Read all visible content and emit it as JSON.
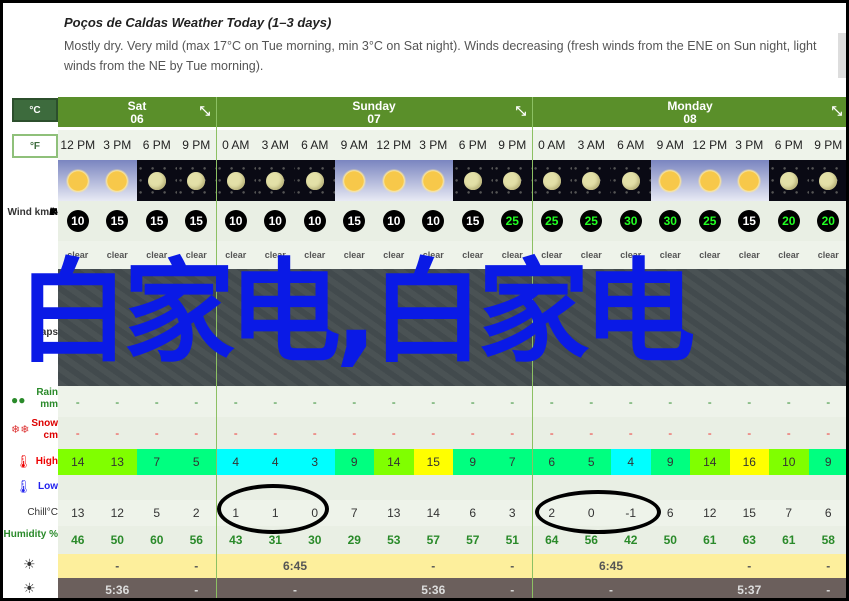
{
  "header": {
    "title": "Poços de Caldas Weather Today (1–3 days)",
    "description_line1": "Mostly dry. Very mild (max 17°C on Tue morning, min 3°C on Sat night). Winds decreasing (fresh winds from the ENE on Sun night, light",
    "description_line2": "winds from the NE by Tue morning)."
  },
  "units": {
    "celsius": "°C",
    "fahrenheit": "°F",
    "selected": "celsius"
  },
  "row_labels": {
    "wind": "Wind km/h",
    "maps": "Maps",
    "rain": "Rain mm",
    "snow": "Snow cm",
    "high": "High",
    "low": "Low",
    "chill": "Chill°C",
    "humidity": "Humidity %"
  },
  "days": [
    {
      "name": "Sat",
      "date": "06",
      "times": [
        "12 PM",
        "3 PM",
        "6 PM",
        "9 PM"
      ],
      "sky": [
        "day",
        "day",
        "night",
        "night"
      ],
      "wind": [
        10,
        15,
        15,
        15
      ],
      "wind_dir": [
        "→",
        "↗",
        "↗",
        "↗"
      ],
      "summary": [
        "clear",
        "clear",
        "clear",
        "clear"
      ],
      "rain": [
        "-",
        "-",
        "-",
        "-"
      ],
      "snow": [
        "-",
        "-",
        "-",
        "-"
      ],
      "high": [
        14,
        13,
        7,
        5
      ],
      "low": [
        "",
        "",
        "",
        ""
      ],
      "chill": [
        13,
        12,
        5,
        2
      ],
      "humidity": [
        46,
        50,
        60,
        56
      ],
      "sunrise": [
        [
          "",
          1
        ],
        [
          "-",
          1
        ],
        [
          "",
          1
        ],
        [
          "-",
          1
        ]
      ],
      "sunset": [
        [
          "",
          1
        ],
        [
          "5:36",
          1
        ],
        [
          "",
          1
        ],
        [
          "-",
          1
        ]
      ]
    },
    {
      "name": "Sunday",
      "date": "07",
      "times": [
        "0 AM",
        "3 AM",
        "6 AM",
        "9 AM",
        "12 PM",
        "3 PM",
        "6 PM",
        "9 PM"
      ],
      "sky": [
        "night",
        "night",
        "night",
        "day",
        "day",
        "day",
        "night",
        "night"
      ],
      "wind": [
        10,
        10,
        10,
        15,
        10,
        10,
        15,
        25
      ],
      "wind_dir": [
        "↖",
        "↖",
        "↖",
        "←",
        "↙",
        "←",
        "←",
        "↙"
      ],
      "summary": [
        "clear",
        "clear",
        "clear",
        "clear",
        "clear",
        "clear",
        "clear",
        "clear"
      ],
      "rain": [
        "-",
        "-",
        "-",
        "-",
        "-",
        "-",
        "-",
        "-"
      ],
      "snow": [
        "-",
        "-",
        "-",
        "-",
        "-",
        "-",
        "-",
        "-"
      ],
      "high": [
        4,
        4,
        3,
        9,
        14,
        15,
        9,
        7
      ],
      "low": [
        "",
        "",
        "",
        "",
        "",
        "",
        "",
        ""
      ],
      "chill": [
        1,
        1,
        0,
        7,
        13,
        14,
        6,
        3
      ],
      "humidity": [
        43,
        31,
        30,
        29,
        53,
        57,
        57,
        51
      ],
      "sunrise": [
        [
          "",
          1
        ],
        [
          "6:45",
          2
        ],
        [
          "",
          1
        ],
        [
          "",
          1
        ],
        [
          "-",
          1
        ],
        [
          "",
          1
        ],
        [
          "-",
          1
        ]
      ],
      "sunset": [
        [
          "",
          1
        ],
        [
          "-",
          2
        ],
        [
          "",
          1
        ],
        [
          "",
          1
        ],
        [
          "5:36",
          1
        ],
        [
          "",
          1
        ],
        [
          "-",
          1
        ]
      ]
    },
    {
      "name": "Monday",
      "date": "08",
      "times": [
        "0 AM",
        "3 AM",
        "6 AM",
        "9 AM",
        "12 PM",
        "3 PM",
        "6 PM",
        "9 PM"
      ],
      "sky": [
        "night",
        "night",
        "night",
        "day",
        "day",
        "day",
        "night",
        "night"
      ],
      "wind": [
        25,
        25,
        30,
        30,
        25,
        15,
        20,
        20
      ],
      "wind_dir": [
        "↙",
        "↙",
        "↙",
        "↙",
        "↙",
        "↙",
        "↙",
        "↙"
      ],
      "summary": [
        "clear",
        "clear",
        "clear",
        "clear",
        "clear",
        "clear",
        "clear",
        "clear"
      ],
      "rain": [
        "-",
        "-",
        "-",
        "-",
        "-",
        "-",
        "-",
        "-"
      ],
      "snow": [
        "-",
        "-",
        "-",
        "-",
        "-",
        "-",
        "-",
        "-"
      ],
      "high": [
        6,
        5,
        4,
        9,
        14,
        16,
        10,
        9
      ],
      "low": [
        "",
        "",
        "",
        "",
        "",
        "",
        "",
        ""
      ],
      "chill": [
        2,
        0,
        -1,
        6,
        12,
        15,
        7,
        6
      ],
      "humidity": [
        64,
        56,
        42,
        50,
        61,
        63,
        61,
        58
      ],
      "sunrise": [
        [
          "",
          1
        ],
        [
          "6:45",
          2
        ],
        [
          "",
          1
        ],
        [
          "",
          1
        ],
        [
          "-",
          1
        ],
        [
          "",
          1
        ],
        [
          "-",
          1
        ]
      ],
      "sunset": [
        [
          "",
          1
        ],
        [
          "-",
          2
        ],
        [
          "",
          1
        ],
        [
          "",
          1
        ],
        [
          "5:37",
          1
        ],
        [
          "",
          1
        ],
        [
          "-",
          1
        ]
      ]
    }
  ],
  "colors": {
    "header_green": "#5a8f2a",
    "temp_scale": {
      "3-4": "#00ffff",
      "5-9": "#00ff80",
      "10-14": "#80ff00",
      "15-16": "#ffff00"
    },
    "wind_strong": "#22ff22",
    "sunrise_bg": "#fdef9c",
    "sunset_bg": "#6b5f5c"
  },
  "watermark": "白家电,白家电"
}
